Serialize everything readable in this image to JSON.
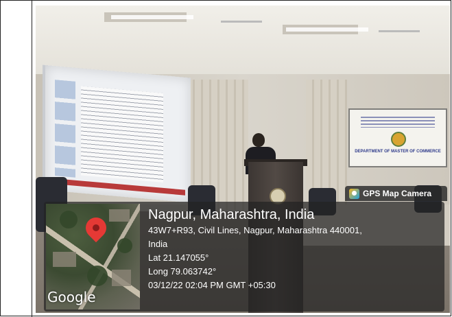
{
  "gps_camera": {
    "badge_label": "GPS Map Camera",
    "location_title": "Nagpur, Maharashtra, India",
    "address_line1": "43W7+R93, Civil Lines, Nagpur, Maharashtra 440001,",
    "address_line2": "India",
    "latitude": "Lat 21.147055°",
    "longitude": "Long 79.063742°",
    "timestamp": "03/12/22 02:04 PM GMT +05:30",
    "map_attribution": "Google",
    "pin_color": "#e53935"
  },
  "scene": {
    "banner_text": "DEPARTMENT OF MASTER OF COMMERCE"
  }
}
